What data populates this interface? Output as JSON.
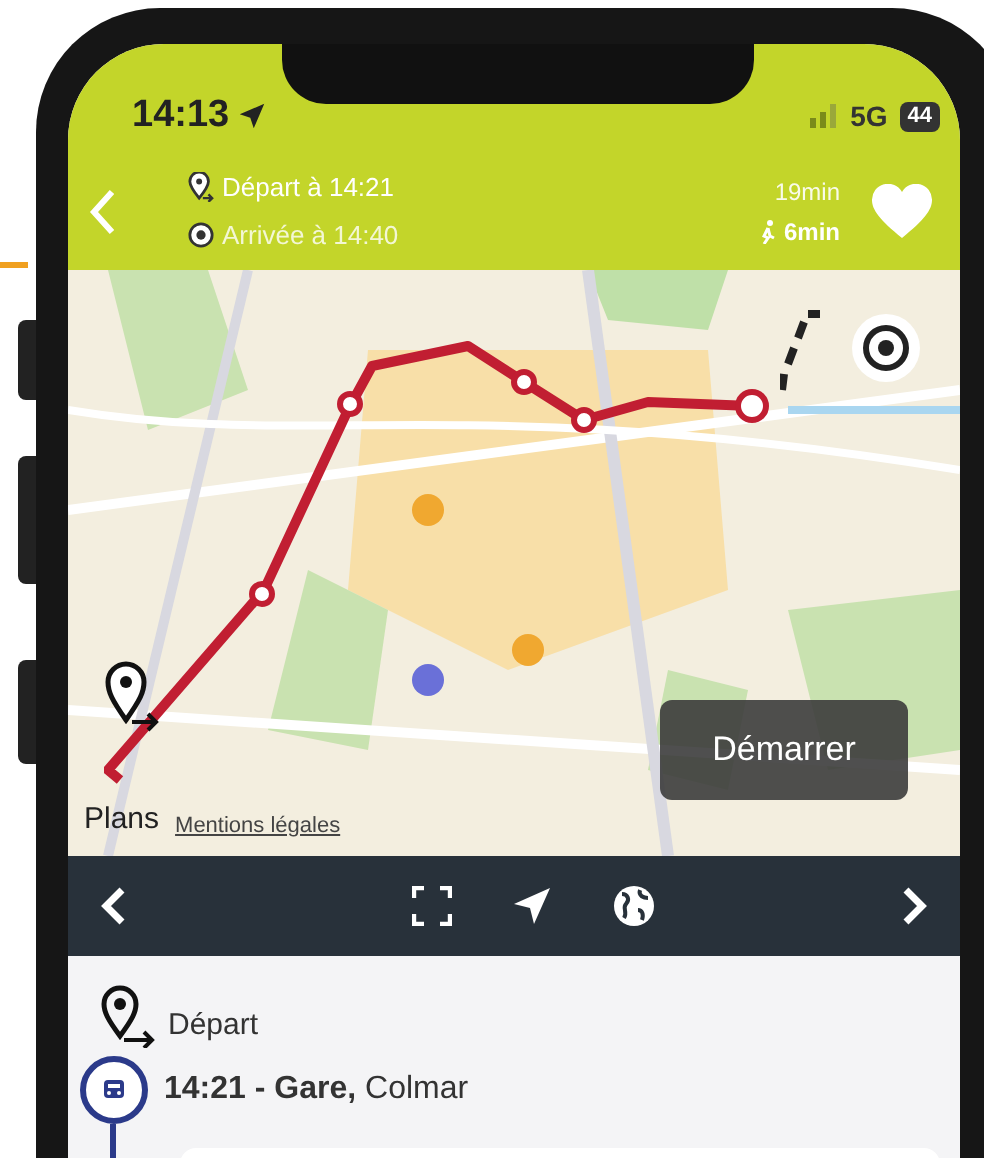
{
  "status_bar": {
    "time": "14:13",
    "network": "5G",
    "battery": "44"
  },
  "header": {
    "departure": "Départ à 14:21",
    "arrival": "Arrivée à 14:40",
    "duration": "19min",
    "walk": "6min"
  },
  "map": {
    "start_button": "Démarrer",
    "attribution": "Plans",
    "legal_link": "Mentions légales"
  },
  "itinerary": {
    "departure_label": "Départ",
    "first_stop": "**14:21 - Gare,** Colmar"
  }
}
